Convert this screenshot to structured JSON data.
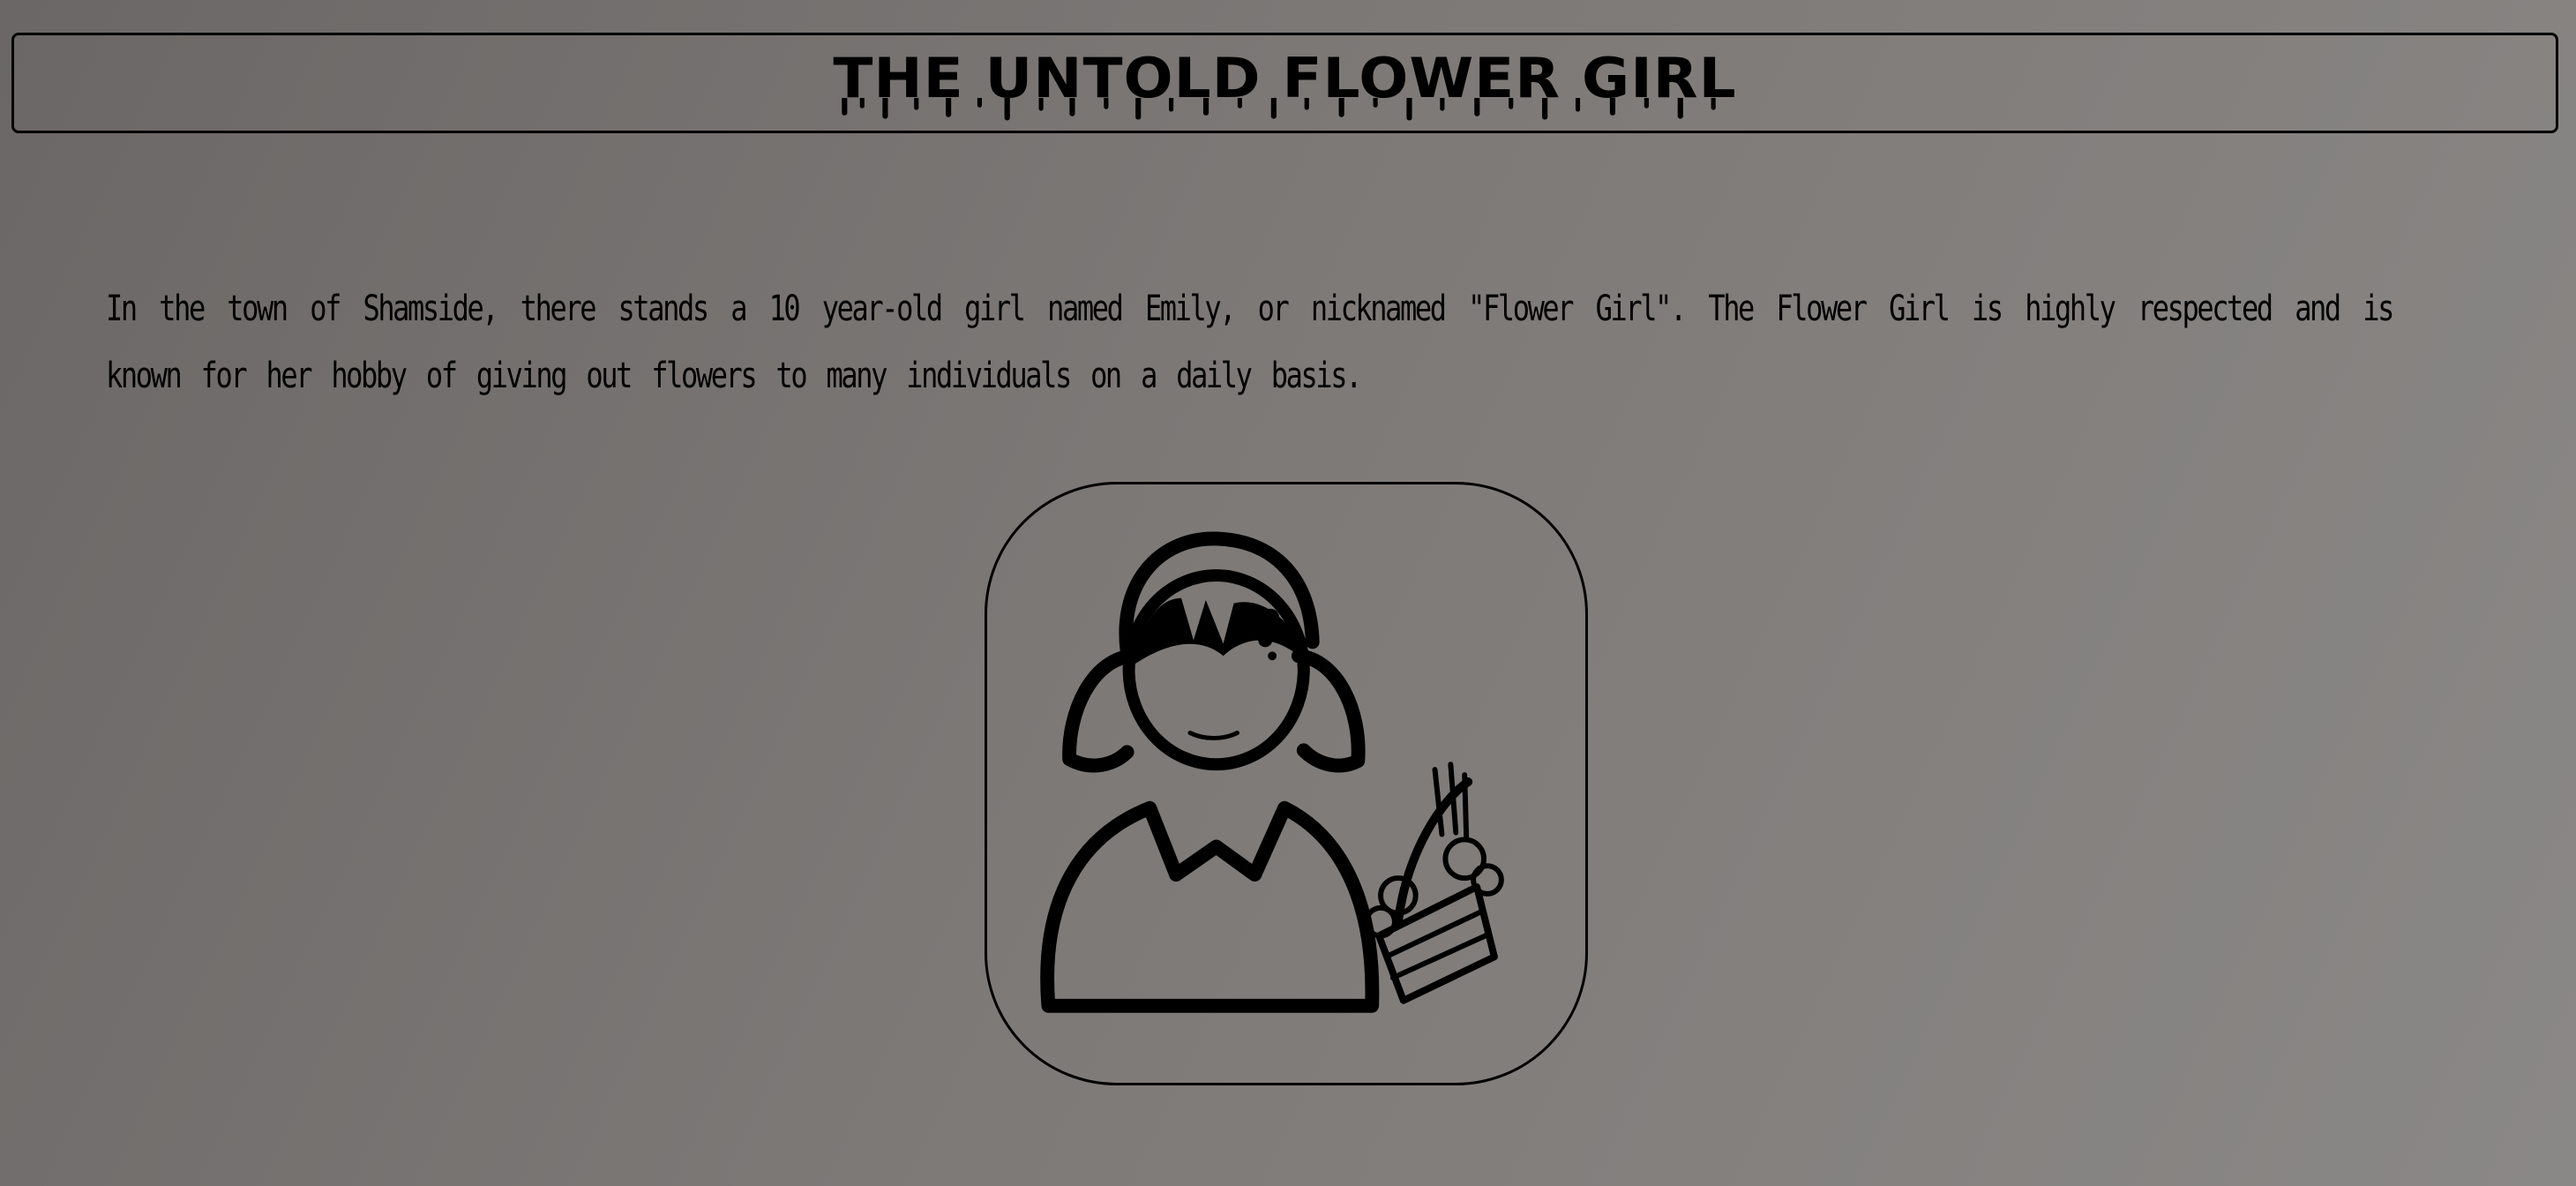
{
  "header": {
    "title": "THE UNTOLD FLOWER GIRL"
  },
  "story": {
    "paragraph": "In the town of Shamside, there stands a 10 year-old girl named Emily, or nicknamed \"Flower Girl\". The Flower Girl is highly respected and is known for her hobby of giving out flowers to many individuals on a daily basis."
  },
  "portrait": {
    "icon": "flower-girl-illustration"
  },
  "colors": {
    "background_dark": "#6a6766",
    "background_light": "#8a8886",
    "ink": "#000000"
  }
}
